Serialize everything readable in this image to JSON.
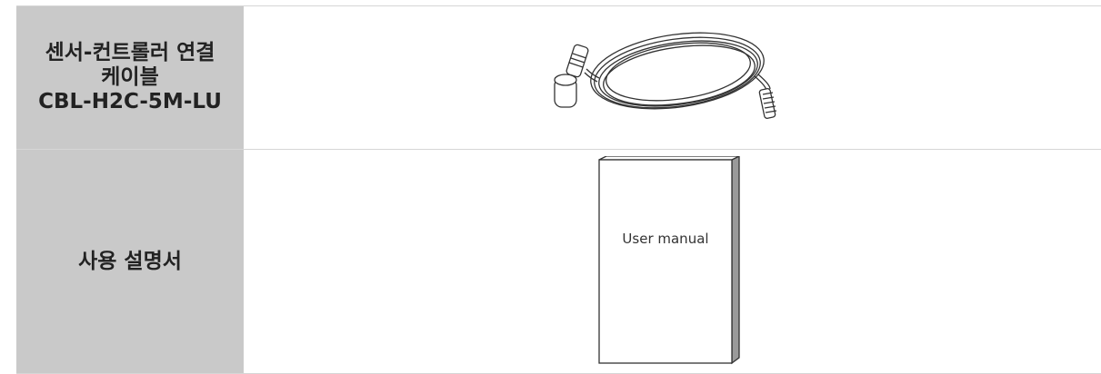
{
  "rows": [
    {
      "label_lines": [
        "센서-컨트롤러 연결",
        "케이블",
        "CBL-H2C-5M-LU"
      ],
      "image_icon": "cable-icon"
    },
    {
      "label_lines": [
        "사용 설명서"
      ],
      "image_icon": "user-manual-icon",
      "image_text": "User manual"
    }
  ]
}
